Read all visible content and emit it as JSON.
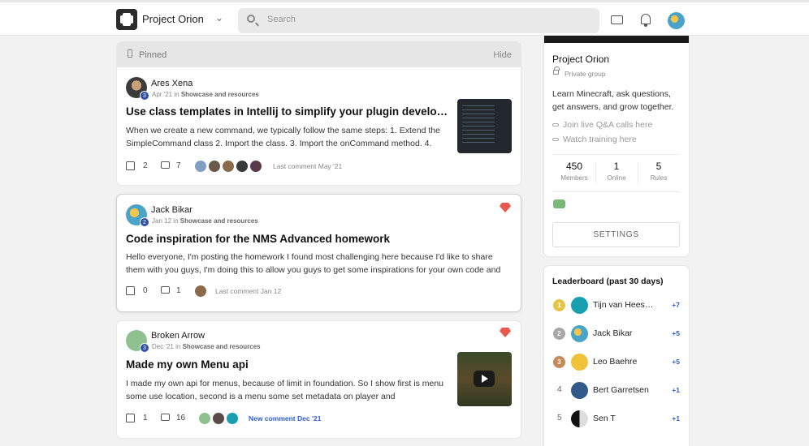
{
  "header": {
    "group_name": "Project Orion",
    "search_placeholder": "Search"
  },
  "pinned": {
    "label": "Pinned",
    "hide_label": "Hide"
  },
  "posts": [
    {
      "author": "Ares Xena",
      "level": "3",
      "date": "Apr '21",
      "in": "in",
      "category": "Showcase and resources",
      "title": "Use class templates in Intellij to simplify your plugin developme…",
      "body": "When we create a new command, we typically follow the same steps: 1. Extend the SimpleCommand class 2. Import the class. 3. Import the onCommand method. 4.",
      "likes": "2",
      "comments": "7",
      "last_comment": "Last comment May '21",
      "thumbnail": "code-screenshot"
    },
    {
      "author": "Jack Bikar",
      "level": "2",
      "date": "Jan 12",
      "in": "in",
      "category": "Showcase and resources",
      "title": "Code inspiration for the NMS Advanced homework",
      "body": "Hello everyone, I'm posting the homework I found most challenging here because I'd like to share them with you guys, I'm doing this to allow you guys to get some inspirations for your own code and",
      "likes": "0",
      "comments": "1",
      "last_comment": "Last comment Jan 12",
      "gem": true
    },
    {
      "author": "Broken Arrow",
      "level": "3",
      "date": "Dec '21",
      "in": "in",
      "category": "Showcase and resources",
      "title": "Made my own Menu api",
      "body": "I made my own api for menus, because of limit in foundation. So I show first is menu some use location, second is a menu some set metadata on player and",
      "likes": "1",
      "comments": "16",
      "last_comment": "New comment Dec '21",
      "thumbnail": "video",
      "gem": true
    }
  ],
  "about": {
    "title": "Project Orion",
    "privacy": "Private group",
    "description": "Learn Minecraft, ask questions, get answers, and grow together.",
    "links": [
      "Join live Q&A calls here",
      "Watch training here"
    ],
    "stats": [
      {
        "value": "450",
        "label": "Members"
      },
      {
        "value": "1",
        "label": "Online"
      },
      {
        "value": "5",
        "label": "Rules"
      }
    ],
    "settings_label": "SETTINGS"
  },
  "leaderboard": {
    "title": "Leaderboard (past 30 days)",
    "entries": [
      {
        "rank": "1",
        "name": "Tijn van Heese…",
        "points": "+7",
        "medal_color": "#e8c34a"
      },
      {
        "rank": "2",
        "name": "Jack Bikar",
        "points": "+5",
        "medal_color": "#a8a8a8"
      },
      {
        "rank": "3",
        "name": "Leo Baehre",
        "points": "+5",
        "medal_color": "#c48a5a"
      },
      {
        "rank": "4",
        "name": "Bert Garretsen",
        "points": "+1"
      },
      {
        "rank": "5",
        "name": "Sen T",
        "points": "+1"
      }
    ]
  },
  "colors": {
    "accent_blue": "#2a5bd7",
    "gem_red": "#e8584d",
    "level_badge": "#2f4fa8"
  }
}
